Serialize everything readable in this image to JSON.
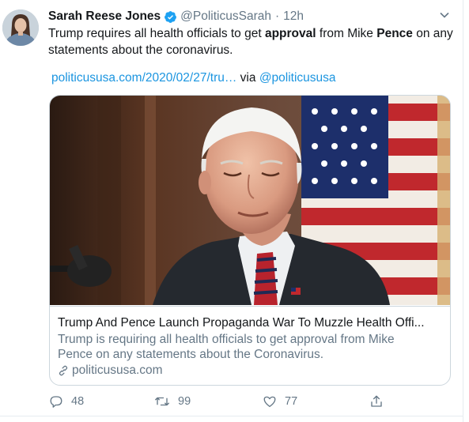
{
  "tweet": {
    "author_name": "Sarah Reese Jones",
    "author_handle": "@PoliticusSarah",
    "separator": "·",
    "time": "12h",
    "text_part1": "Trump requires all health officials to get ",
    "text_bold1": "approval",
    "text_part2": " from Mike ",
    "text_bold2": "Pence",
    "text_part3": " on any statements about the coronavirus.",
    "link_text": "politicususa.com/2020/02/27/tru…",
    "via_text": "via",
    "via_handle": "@politicususa"
  },
  "card": {
    "title": "Trump And Pence Launch Propaganda War To Muzzle Health Offi...",
    "description": "Trump is requiring all health officials to get approval from Mike Pence on any statements about the Coronavirus.",
    "domain": "politicususa.com"
  },
  "actions": {
    "replies": "48",
    "retweets": "99",
    "likes": "77"
  },
  "icons": {
    "verified": "verified-badge-icon",
    "caret": "chevron-down-icon",
    "link": "link-icon",
    "reply": "reply-icon",
    "retweet": "retweet-icon",
    "like": "heart-icon",
    "share": "share-icon"
  },
  "colors": {
    "link_blue": "#1b95e0",
    "secondary_text": "#657786",
    "border": "#ccd6dd"
  }
}
